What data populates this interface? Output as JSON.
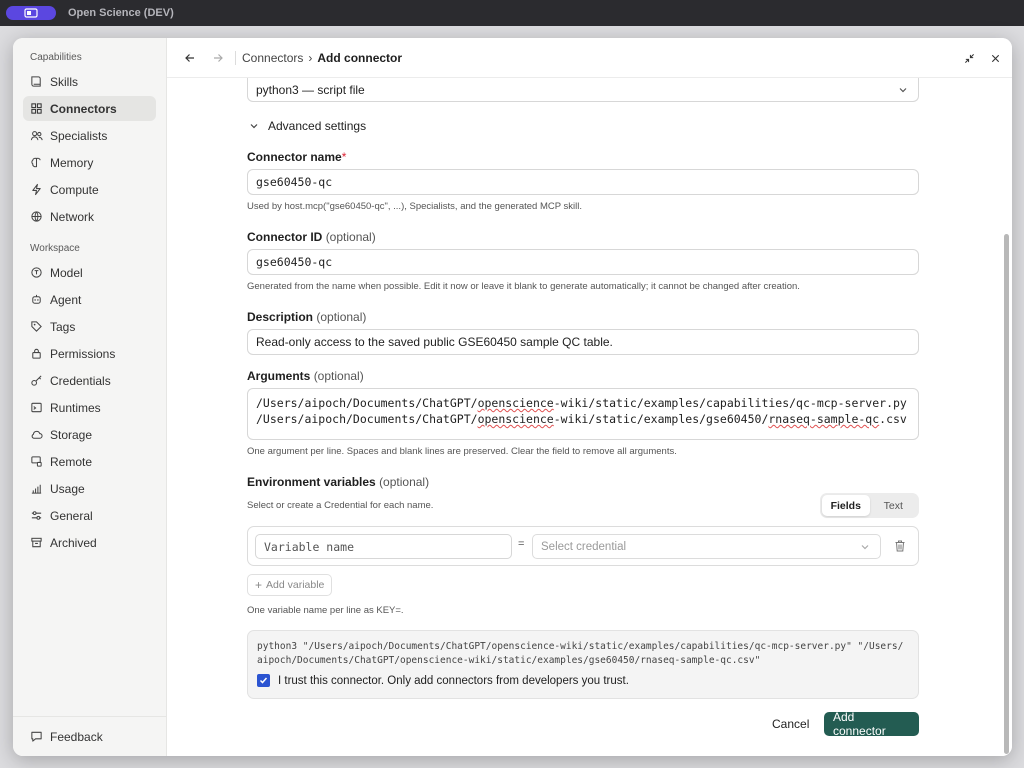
{
  "window": {
    "title": "Open Science (DEV)"
  },
  "sidebar": {
    "capabilities_heading": "Capabilities",
    "capabilities": [
      {
        "label": "Skills",
        "icon": "book-icon"
      },
      {
        "label": "Connectors",
        "icon": "grid-icon",
        "active": true
      },
      {
        "label": "Specialists",
        "icon": "users-icon"
      },
      {
        "label": "Memory",
        "icon": "brain-icon"
      },
      {
        "label": "Compute",
        "icon": "bolt-icon"
      },
      {
        "label": "Network",
        "icon": "globe-icon"
      }
    ],
    "workspace_heading": "Workspace",
    "workspace": [
      {
        "label": "Model",
        "icon": "model-icon"
      },
      {
        "label": "Agent",
        "icon": "agent-icon"
      },
      {
        "label": "Tags",
        "icon": "tag-icon"
      },
      {
        "label": "Permissions",
        "icon": "lock-icon"
      },
      {
        "label": "Credentials",
        "icon": "key-icon"
      },
      {
        "label": "Runtimes",
        "icon": "terminal-icon"
      },
      {
        "label": "Storage",
        "icon": "cloud-icon"
      },
      {
        "label": "Remote",
        "icon": "remote-icon"
      },
      {
        "label": "Usage",
        "icon": "chart-icon"
      },
      {
        "label": "General",
        "icon": "sliders-icon"
      },
      {
        "label": "Archived",
        "icon": "archive-icon"
      }
    ],
    "feedback_label": "Feedback"
  },
  "header": {
    "breadcrumb_parent": "Connectors",
    "breadcrumb_separator": "›",
    "breadcrumb_current": "Add connector"
  },
  "form": {
    "runtime_value": "python3 — script file",
    "advanced_label": "Advanced settings",
    "name": {
      "label": "Connector name",
      "required_mark": "*",
      "value": "gse60450-qc",
      "help": "Used by host.mcp(\"gse60450-qc\", ...), Specialists, and the generated MCP skill."
    },
    "id": {
      "label": "Connector ID",
      "optional": "(optional)",
      "value": "gse60450-qc",
      "help": "Generated from the name when possible. Edit it now or leave it blank to generate automatically; it cannot be changed after creation."
    },
    "description": {
      "label": "Description",
      "optional": "(optional)",
      "value": "Read-only access to the saved public GSE60450 sample QC table."
    },
    "arguments": {
      "label": "Arguments",
      "optional": "(optional)",
      "line1_pre": "/Users/aipoch/Documents/ChatGPT/",
      "line1_mid": "openscience",
      "line1_post": "-wiki/static/examples/capabilities/qc-mcp-server.py",
      "line2_pre": "/Users/aipoch/Documents/ChatGPT/",
      "line2_mid": "openscience",
      "line2_post": "-wiki/static/examples/gse60450/",
      "line2_squig": "rnaseq-sample-qc",
      "line2_end": ".csv",
      "help": "One argument per line. Spaces and blank lines are preserved. Clear the field to remove all arguments."
    },
    "env": {
      "label": "Environment variables",
      "optional": "(optional)",
      "help": "Select or create a Credential for each name.",
      "tab_fields": "Fields",
      "tab_text": "Text",
      "var_placeholder": "Variable name",
      "equals": "=",
      "credential_placeholder": "Select credential",
      "add_variable": "Add variable",
      "add_plus": "+",
      "format_help": "One variable name per line as KEY=."
    },
    "command_preview": "python3 \"/Users/aipoch/Documents/ChatGPT/openscience-wiki/static/examples/capabilities/qc-mcp-server.py\" \"/Users/aipoch/Documents/ChatGPT/openscience-wiki/static/examples/gse60450/rnaseq-sample-qc.csv\"",
    "trust_label": "I trust this connector. Only add connectors from developers you trust.",
    "trust_checked": true
  },
  "actions": {
    "cancel_label": "Cancel",
    "submit_label": "Add connector"
  },
  "colors": {
    "accent": "#5b47e0",
    "primary_button": "#235c52",
    "checkbox": "#2b54d1",
    "required": "#dd2233"
  }
}
